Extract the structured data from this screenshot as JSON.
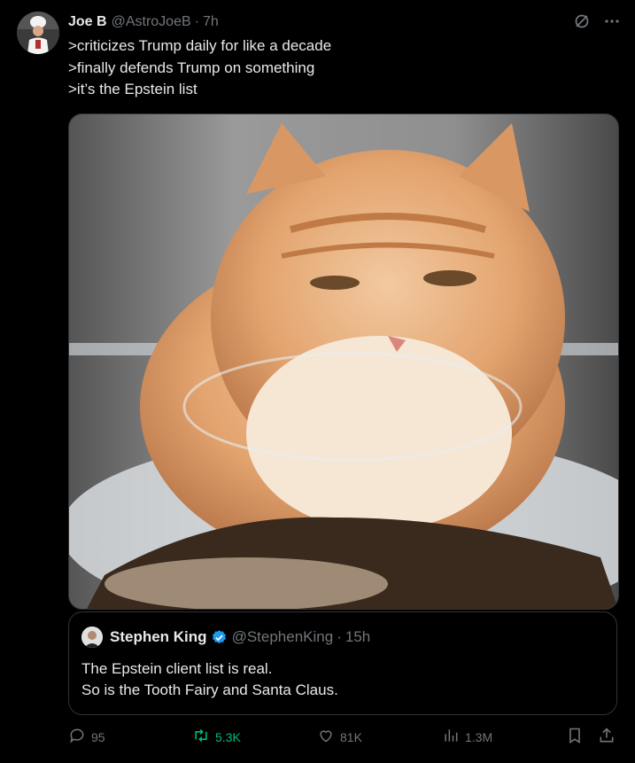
{
  "tweet": {
    "author_name": "Joe B",
    "author_handle": "@AstroJoeB",
    "separator": "·",
    "time": "7h",
    "lines": [
      ">criticizes Trump daily for like a decade",
      ">finally defends Trump on something",
      ">it’s the Epstein list"
    ]
  },
  "quote": {
    "author_name": "Stephen King",
    "author_handle": "@StephenKing",
    "separator": "·",
    "time": "15h",
    "lines": [
      "The Epstein client list is real.",
      "So is the Tooth Fairy and Santa Claus."
    ]
  },
  "actions": {
    "replies": "95",
    "retweets": "5.3K",
    "likes": "81K",
    "views": "1.3M"
  },
  "colors": {
    "background": "#000000",
    "text": "#e7e9ea",
    "muted": "#71767b",
    "border": "#2f3336",
    "retweet_active": "#00ba7c",
    "verified": "#1d9bf0"
  },
  "icons": {
    "grok": "grok-icon",
    "more": "more-icon",
    "reply": "reply-icon",
    "retweet": "retweet-icon",
    "like": "heart-icon",
    "views": "views-icon",
    "bookmark": "bookmark-icon",
    "share": "share-icon"
  }
}
